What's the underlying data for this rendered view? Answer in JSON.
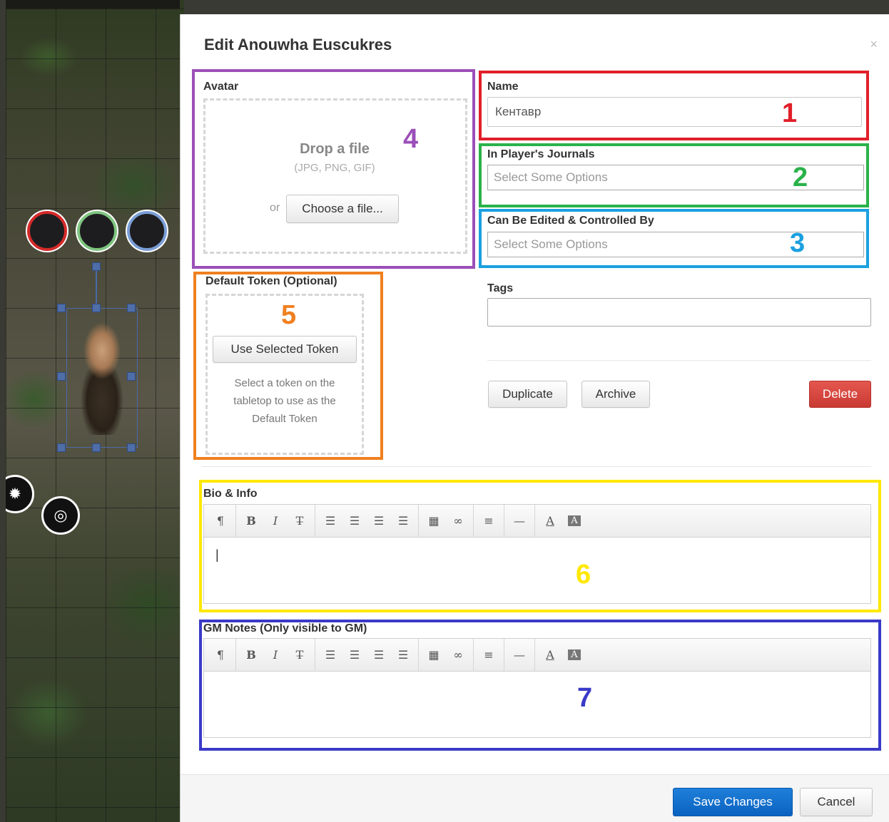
{
  "modal": {
    "title": "Edit Anouwha Euscukres",
    "close_icon": "×"
  },
  "avatar": {
    "label": "Avatar",
    "drop_title": "Drop a file",
    "drop_types": "(JPG, PNG, GIF)",
    "or_text": "or",
    "choose_label": "Choose a file..."
  },
  "name": {
    "label": "Name",
    "value": "Кентавр"
  },
  "journals": {
    "label": "In Player's Journals",
    "placeholder": "Select Some Options"
  },
  "controlled": {
    "label": "Can Be Edited & Controlled By",
    "placeholder": "Select Some Options"
  },
  "tags": {
    "label": "Tags",
    "value": ""
  },
  "token": {
    "label": "Default Token (Optional)",
    "use_selected_label": "Use Selected Token",
    "hint": "Select a token on the tabletop to use as the Default Token"
  },
  "actions": {
    "duplicate_label": "Duplicate",
    "archive_label": "Archive",
    "delete_label": "Delete"
  },
  "bio": {
    "label": "Bio & Info",
    "content": "|"
  },
  "gm_notes": {
    "label": "GM Notes (Only visible to GM)",
    "content": ""
  },
  "toolbar_icons": {
    "paragraph": "¶",
    "bold": "B",
    "italic": "I",
    "strike": "T̶",
    "bullet_list": "☰",
    "numbered_list": "☰",
    "outdent": "☰",
    "indent": "☰",
    "table": "▦",
    "link": "∞",
    "align": "≡",
    "hr": "—",
    "font_color": "A",
    "bg_color": "A"
  },
  "footer": {
    "save_label": "Save Changes",
    "cancel_label": "Cancel"
  },
  "annotations": {
    "n1": "1",
    "n2": "2",
    "n3": "3",
    "n4": "4",
    "n5": "5",
    "n6": "6",
    "n7": "7",
    "colors": {
      "name": "#e0202a",
      "journals": "#2ab24a",
      "controlled": "#1aa0e0",
      "avatar": "#9b4fb8",
      "token": "#f08020",
      "bio": "#ffe800",
      "gm": "#3a3ac8"
    }
  },
  "map": {
    "token_bars": [
      "#d42a2a",
      "#7fc47f",
      "#7a9ed6"
    ],
    "settings_icon": "gear-icon",
    "target_icon": "target-icon"
  }
}
